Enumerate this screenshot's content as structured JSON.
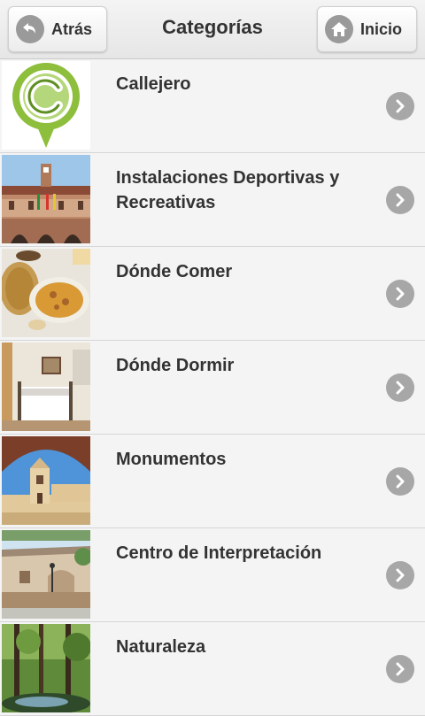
{
  "header": {
    "title": "Categorías",
    "back_label": "Atrás",
    "home_label": "Inicio"
  },
  "categories": [
    {
      "label": "Callejero",
      "thumb": "callejero-logo"
    },
    {
      "label": "Instalaciones Deportivas y Recreativas",
      "thumb": "town-hall-photo"
    },
    {
      "label": "Dónde Comer",
      "thumb": "food-photo"
    },
    {
      "label": "Dónde Dormir",
      "thumb": "bedroom-photo"
    },
    {
      "label": "Monumentos",
      "thumb": "church-photo"
    },
    {
      "label": "Centro de Interpretación",
      "thumb": "building-photo"
    },
    {
      "label": "Naturaleza",
      "thumb": "forest-photo"
    }
  ],
  "colors": {
    "background": "#f4f4f4",
    "text": "#333333",
    "chevron_circle": "#a7a7a7",
    "logo_green": "#8dbe3c"
  }
}
